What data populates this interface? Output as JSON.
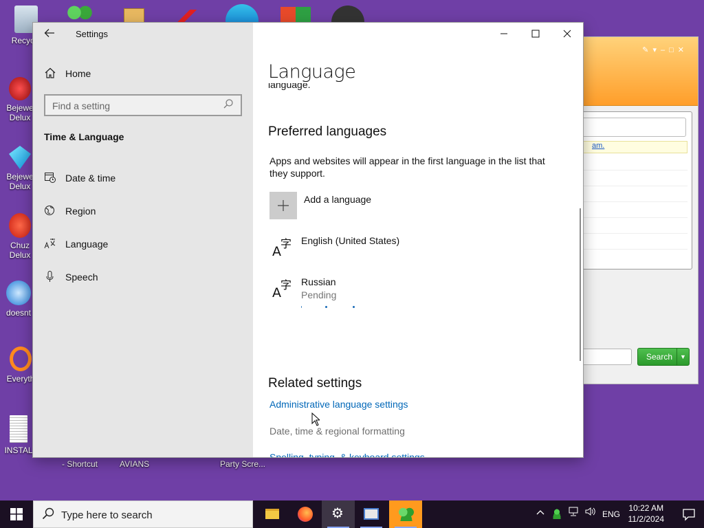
{
  "desktop": {
    "icons": [
      {
        "label": "Recycle"
      },
      {
        "label": "Bejewe Delux"
      },
      {
        "label": "Bejewe Delux"
      },
      {
        "label": "Chuz Delux"
      },
      {
        "label": "doesnt"
      },
      {
        "label": "Everyth"
      },
      {
        "label": "INSTAL"
      }
    ],
    "bottom_labels": [
      "- Shortcut",
      "AVIANS",
      "Party Scre..."
    ]
  },
  "background_app": {
    "note_text": "am.",
    "search_button": "Search"
  },
  "settings": {
    "window_title": "Settings",
    "sidebar": {
      "home": "Home",
      "search_placeholder": "Find a setting",
      "section": "Time & Language",
      "items": [
        {
          "label": "Date & time",
          "icon": "calendar-clock-icon"
        },
        {
          "label": "Region",
          "icon": "globe-icon"
        },
        {
          "label": "Language",
          "icon": "language-icon"
        },
        {
          "label": "Speech",
          "icon": "microphone-icon"
        }
      ]
    },
    "content": {
      "title": "Language",
      "cut_text": "language.",
      "preferred_heading": "Preferred languages",
      "preferred_desc": "Apps and websites will appear in the first language in the list that they support.",
      "add_language": "Add a language",
      "languages": [
        {
          "name": "English (United States)",
          "status": ""
        },
        {
          "name": "Russian",
          "status": "Pending"
        }
      ],
      "related_heading": "Related settings",
      "related_links": [
        "Administrative language settings",
        "Date, time & regional formatting",
        "Spelling, typing, & keyboard settings"
      ]
    }
  },
  "taskbar": {
    "search_placeholder": "Type here to search",
    "tray_lang": "ENG",
    "time": "10:22 AM",
    "date": "11/2/2024"
  },
  "colors": {
    "desktop": "#6f3fa6",
    "sidebar": "#e6e6e6",
    "link": "#0067b8",
    "taskbar": "#1b1023"
  }
}
